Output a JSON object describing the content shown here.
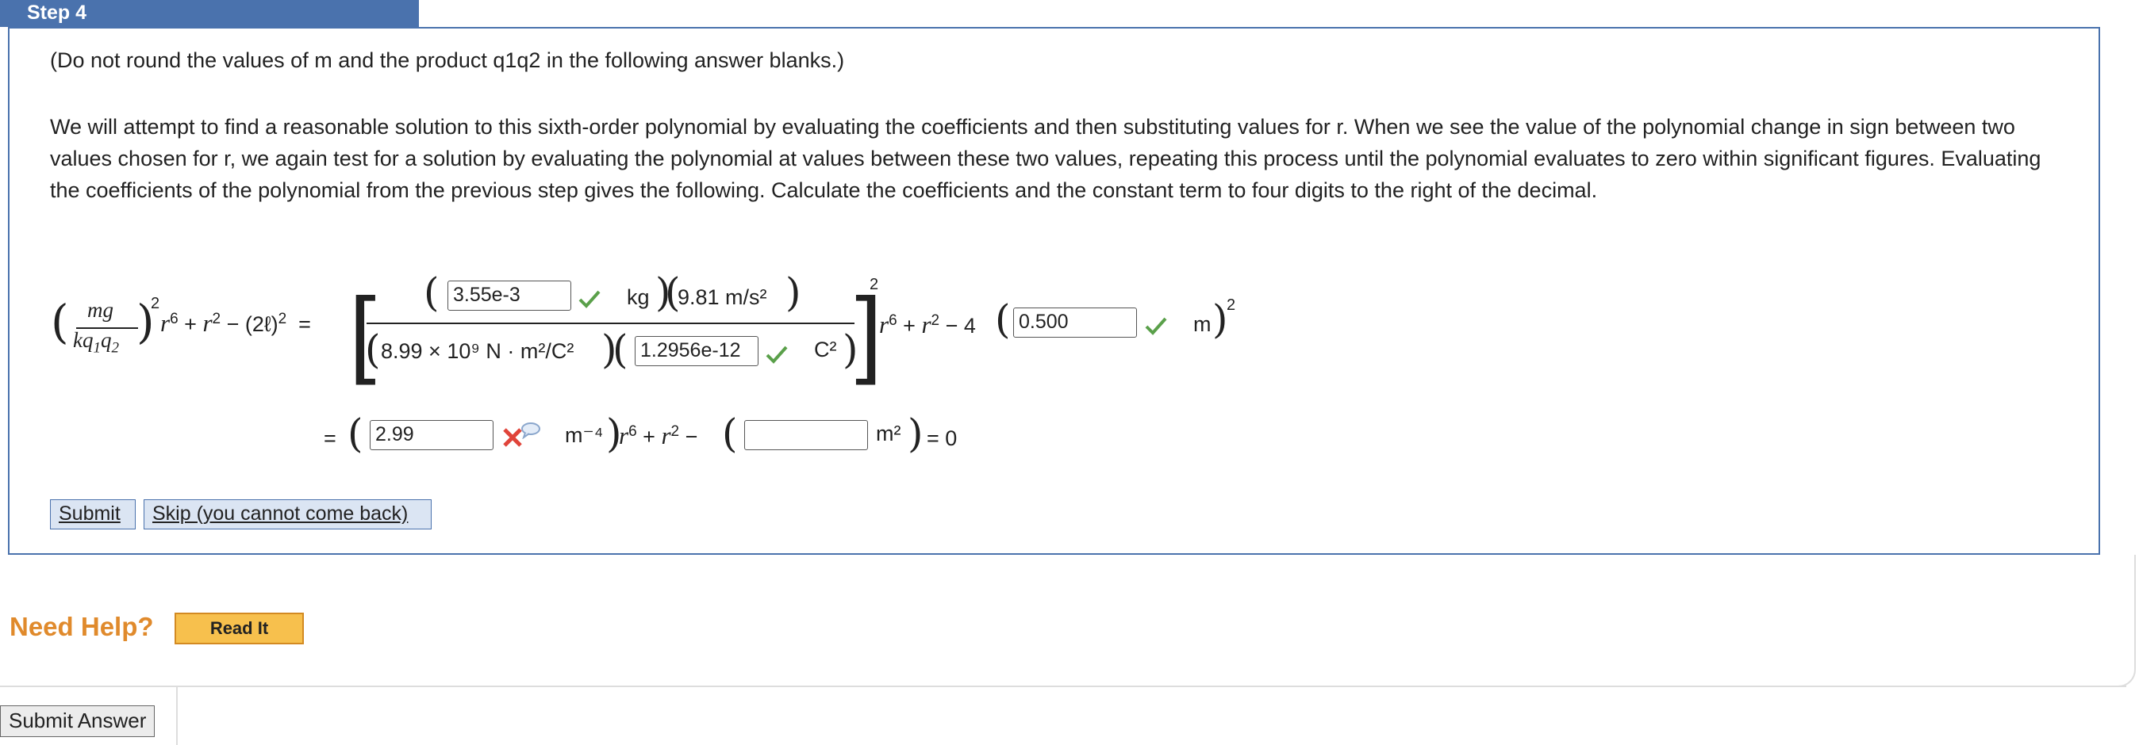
{
  "step": {
    "title": "Step 4"
  },
  "instructions": {
    "note": "(Do not round the values of m and the product q1q2 in the following answer blanks.)",
    "paragraph": "We will attempt to find a reasonable solution to this sixth-order polynomial by evaluating the coefficients and then substituting values for r. When we see the value of the polynomial change in sign between two values chosen for r, we again test for a solution by evaluating the polynomial at values between these two values, repeating this process until the polynomial evaluates to zero within significant figures. Evaluating the coefficients of the polynomial from the previous step gives the following. Calculate the coefficients and the constant term to four digits to the right of the decimal."
  },
  "equation": {
    "mass_value": "3.55e-3",
    "mass_unit": "kg",
    "gravity": "9.81 m/s²",
    "coulomb_constant": "8.99 × 10⁹ N · m²/C²",
    "charge_product_value": "1.2956e-12",
    "charge_product_unit": "C²",
    "length_value": "0.500",
    "length_unit": "m",
    "coef_value": "2.99",
    "coef_unit": "m⁻⁴",
    "const_value": "",
    "const_unit": "m²",
    "equals_zero": "= 0"
  },
  "buttons": {
    "submit": "Submit",
    "skip": "Skip (you cannot come back)",
    "need_help": "Need Help?",
    "read_it": "Read It",
    "submit_answer": "Submit Answer"
  },
  "colors": {
    "accent": "#4a72ad",
    "correct": "#5aa04a",
    "incorrect": "#e0443a",
    "help": "#e08a2c"
  }
}
